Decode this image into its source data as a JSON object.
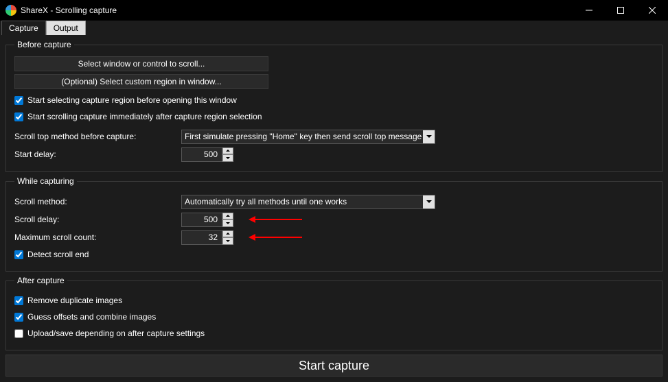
{
  "window": {
    "title": "ShareX - Scrolling capture"
  },
  "tabs": {
    "capture": "Capture",
    "output": "Output"
  },
  "before": {
    "legend": "Before capture",
    "select_window_btn": "Select window or control to scroll...",
    "select_region_btn": "(Optional) Select custom region in window...",
    "chk_start_selecting": "Start selecting capture region before opening this window",
    "chk_start_scrolling": "Start scrolling capture immediately after capture region selection",
    "scroll_top_method_label": "Scroll top method before capture:",
    "scroll_top_method_value": "First simulate pressing \"Home\" key then send scroll top message",
    "start_delay_label": "Start delay:",
    "start_delay_value": "500"
  },
  "while": {
    "legend": "While capturing",
    "scroll_method_label": "Scroll method:",
    "scroll_method_value": "Automatically try all methods until one works",
    "scroll_delay_label": "Scroll delay:",
    "scroll_delay_value": "500",
    "max_scroll_label": "Maximum scroll count:",
    "max_scroll_value": "32",
    "chk_detect_scroll_end": "Detect scroll end"
  },
  "after": {
    "legend": "After capture",
    "chk_remove_dup": "Remove duplicate images",
    "chk_guess_offsets": "Guess offsets and combine images",
    "chk_upload_save": "Upload/save depending on after capture settings"
  },
  "start_capture_btn": "Start capture"
}
